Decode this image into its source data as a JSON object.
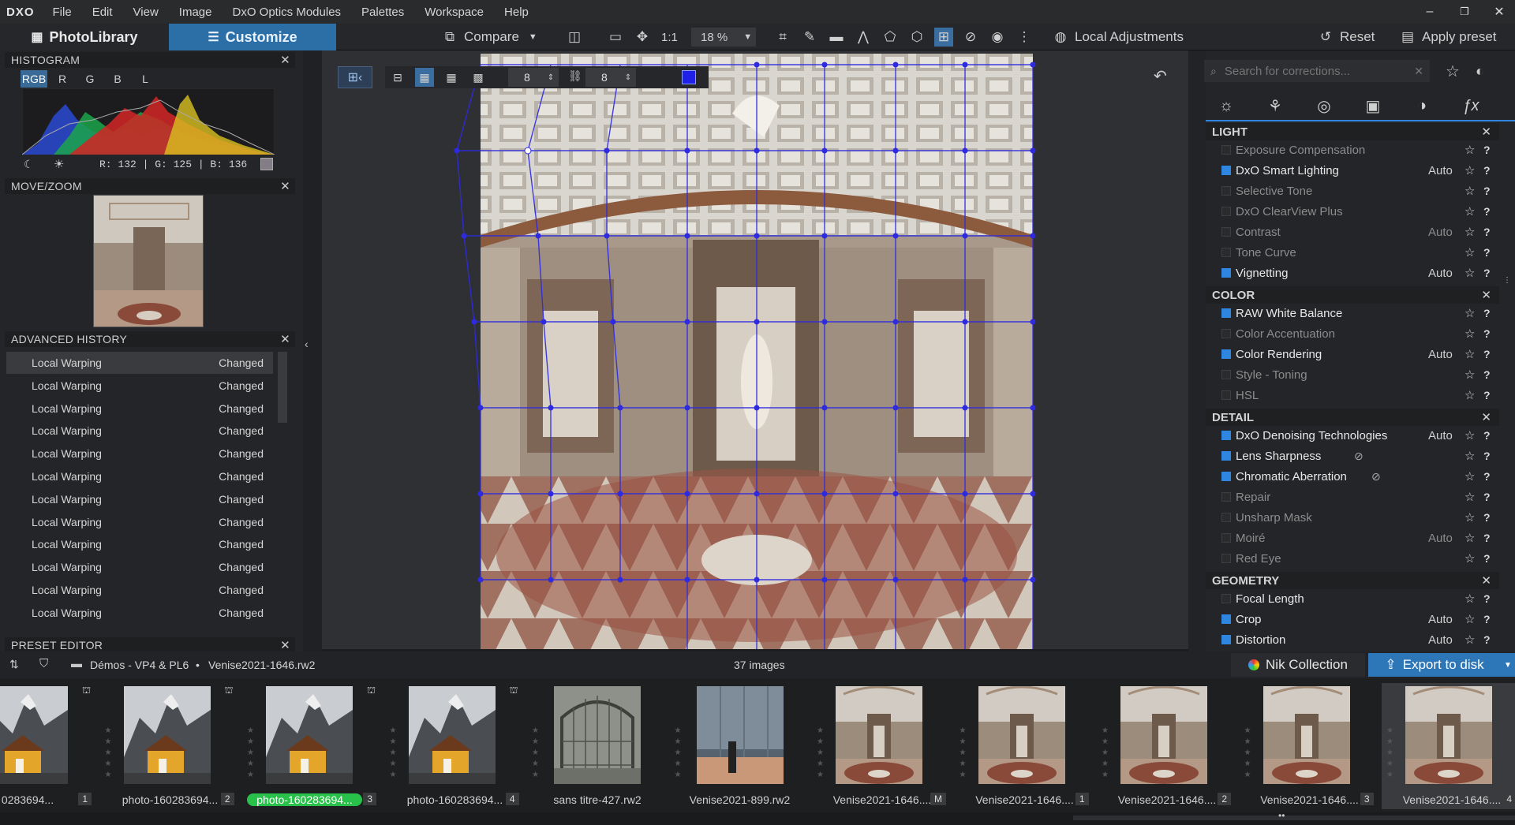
{
  "app": {
    "logo": "DXO"
  },
  "menu": [
    "File",
    "Edit",
    "View",
    "Image",
    "DxO Optics Modules",
    "Palettes",
    "Workspace",
    "Help"
  ],
  "window": {
    "minimize": "–",
    "restore": "❐",
    "close": "✕"
  },
  "tabs": {
    "photolibrary": "PhotoLibrary",
    "customize": "Customize"
  },
  "toolbar": {
    "compare": "Compare",
    "one_to_one": "1:1",
    "zoom": "18 %",
    "local_adjustments": "Local Adjustments",
    "reset": "Reset",
    "apply_preset": "Apply preset"
  },
  "histogram": {
    "title": "HISTOGRAM",
    "channels": [
      "RGB",
      "R",
      "G",
      "B",
      "L"
    ],
    "readout": "R: 132  |  G: 125  |  B: 136"
  },
  "movezoom": {
    "title": "MOVE/ZOOM"
  },
  "history": {
    "title": "ADVANCED HISTORY",
    "items": [
      {
        "name": "Local Warping",
        "state": "Changed"
      },
      {
        "name": "Local Warping",
        "state": "Changed"
      },
      {
        "name": "Local Warping",
        "state": "Changed"
      },
      {
        "name": "Local Warping",
        "state": "Changed"
      },
      {
        "name": "Local Warping",
        "state": "Changed"
      },
      {
        "name": "Local Warping",
        "state": "Changed"
      },
      {
        "name": "Local Warping",
        "state": "Changed"
      },
      {
        "name": "Local Warping",
        "state": "Changed"
      },
      {
        "name": "Local Warping",
        "state": "Changed"
      },
      {
        "name": "Local Warping",
        "state": "Changed"
      },
      {
        "name": "Local Warping",
        "state": "Changed"
      },
      {
        "name": "Local Warping",
        "state": "Changed"
      }
    ]
  },
  "preset_editor": {
    "title": "PRESET EDITOR"
  },
  "warp_tool": {
    "rows": "8",
    "cols": "8"
  },
  "corrections": {
    "search_placeholder": "Search for corrections...",
    "sections": [
      {
        "title": "LIGHT",
        "items": [
          {
            "label": "Exposure Compensation",
            "on": false,
            "auto": "",
            "dim": true
          },
          {
            "label": "DxO Smart Lighting",
            "on": true,
            "auto": "Auto",
            "dim": false
          },
          {
            "label": "Selective Tone",
            "on": false,
            "auto": "",
            "dim": true
          },
          {
            "label": "DxO ClearView Plus",
            "on": false,
            "auto": "",
            "dim": true
          },
          {
            "label": "Contrast",
            "on": false,
            "auto": "Auto",
            "dim": true
          },
          {
            "label": "Tone Curve",
            "on": false,
            "auto": "",
            "dim": true
          },
          {
            "label": "Vignetting",
            "on": true,
            "auto": "Auto",
            "dim": false
          }
        ]
      },
      {
        "title": "COLOR",
        "items": [
          {
            "label": "RAW White Balance",
            "on": true,
            "auto": "",
            "dim": false
          },
          {
            "label": "Color Accentuation",
            "on": false,
            "auto": "",
            "dim": true
          },
          {
            "label": "Color Rendering",
            "on": true,
            "auto": "Auto",
            "dim": false
          },
          {
            "label": "Style - Toning",
            "on": false,
            "auto": "",
            "dim": true
          },
          {
            "label": "HSL",
            "on": false,
            "auto": "",
            "dim": true
          }
        ]
      },
      {
        "title": "DETAIL",
        "items": [
          {
            "label": "DxO Denoising Technologies",
            "on": true,
            "auto": "Auto",
            "dim": false
          },
          {
            "label": "Lens Sharpness",
            "on": true,
            "auto": "",
            "dim": false,
            "eye": true
          },
          {
            "label": "Chromatic Aberration",
            "on": true,
            "auto": "",
            "dim": false,
            "eye": true
          },
          {
            "label": "Repair",
            "on": false,
            "auto": "",
            "dim": true
          },
          {
            "label": "Unsharp Mask",
            "on": false,
            "auto": "",
            "dim": true
          },
          {
            "label": "Moiré",
            "on": false,
            "auto": "Auto",
            "dim": true
          },
          {
            "label": "Red Eye",
            "on": false,
            "auto": "",
            "dim": true
          }
        ]
      },
      {
        "title": "GEOMETRY",
        "items": [
          {
            "label": "Focal Length",
            "on": false,
            "auto": "",
            "dim": false
          },
          {
            "label": "Crop",
            "on": true,
            "auto": "Auto",
            "dim": false
          },
          {
            "label": "Distortion",
            "on": true,
            "auto": "Auto",
            "dim": false
          }
        ]
      }
    ]
  },
  "bottom": {
    "folder_path": "Démos - VP4 & PL6",
    "separator": "•",
    "file": "Venise2021-1646.rw2",
    "count": "37 images",
    "nik": "Nik Collection",
    "export": "Export to disk"
  },
  "filmstrip": [
    {
      "caption": "0283694...",
      "num": "1",
      "type": "mountain",
      "locked": true,
      "highlight": false
    },
    {
      "caption": "photo-160283694...",
      "num": "2",
      "type": "mountain",
      "locked": true,
      "highlight": false
    },
    {
      "caption": "photo-160283694...",
      "num": "3",
      "type": "mountain",
      "locked": true,
      "highlight": true
    },
    {
      "caption": "photo-160283694...",
      "num": "4",
      "type": "mountain",
      "locked": true,
      "highlight": false
    },
    {
      "caption": "sans titre-427.rw2",
      "num": "",
      "type": "greenhouse",
      "locked": false,
      "highlight": false
    },
    {
      "caption": "Venise2021-899.rw2",
      "num": "",
      "type": "glass",
      "locked": false,
      "highlight": false
    },
    {
      "caption": "Venise2021-1646....",
      "num": "M",
      "type": "room",
      "locked": false,
      "highlight": false
    },
    {
      "caption": "Venise2021-1646....",
      "num": "1",
      "type": "room",
      "locked": false,
      "highlight": false
    },
    {
      "caption": "Venise2021-1646....",
      "num": "2",
      "type": "room",
      "locked": false,
      "highlight": false
    },
    {
      "caption": "Venise2021-1646....",
      "num": "3",
      "type": "room",
      "locked": false,
      "highlight": false
    },
    {
      "caption": "Venise2021-1646....",
      "num": "4",
      "type": "room",
      "locked": false,
      "highlight": false,
      "selected": true
    }
  ]
}
